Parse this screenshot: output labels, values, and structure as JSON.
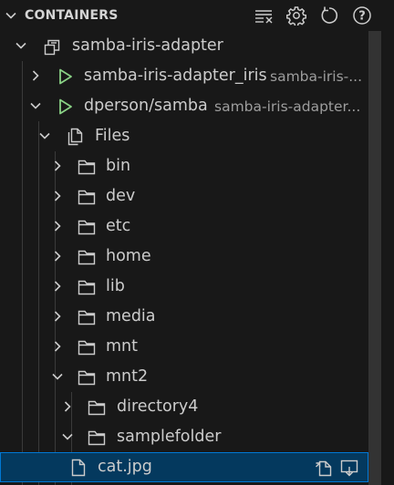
{
  "section": {
    "title": "CONTAINERS",
    "actions": [
      "clear-list-icon",
      "gear-icon",
      "refresh-icon",
      "help-icon"
    ]
  },
  "tree": {
    "group": "samba-iris-adapter",
    "containers": [
      {
        "name": "samba-iris-adapter_iris",
        "description": "samba-iris-..."
      },
      {
        "name": "dperson/samba",
        "description": "samba-iris-adapter..."
      }
    ],
    "files_label": "Files",
    "folders": [
      "bin",
      "dev",
      "etc",
      "home",
      "lib",
      "media",
      "mnt",
      "mnt2"
    ],
    "mnt2_children": [
      "directory4",
      "samplefolder"
    ],
    "selected_file": "cat.jpg"
  },
  "colors": {
    "background": "#181818",
    "selection": "#04395e",
    "selection_border": "#0078d4",
    "running_green": "#89d185"
  }
}
